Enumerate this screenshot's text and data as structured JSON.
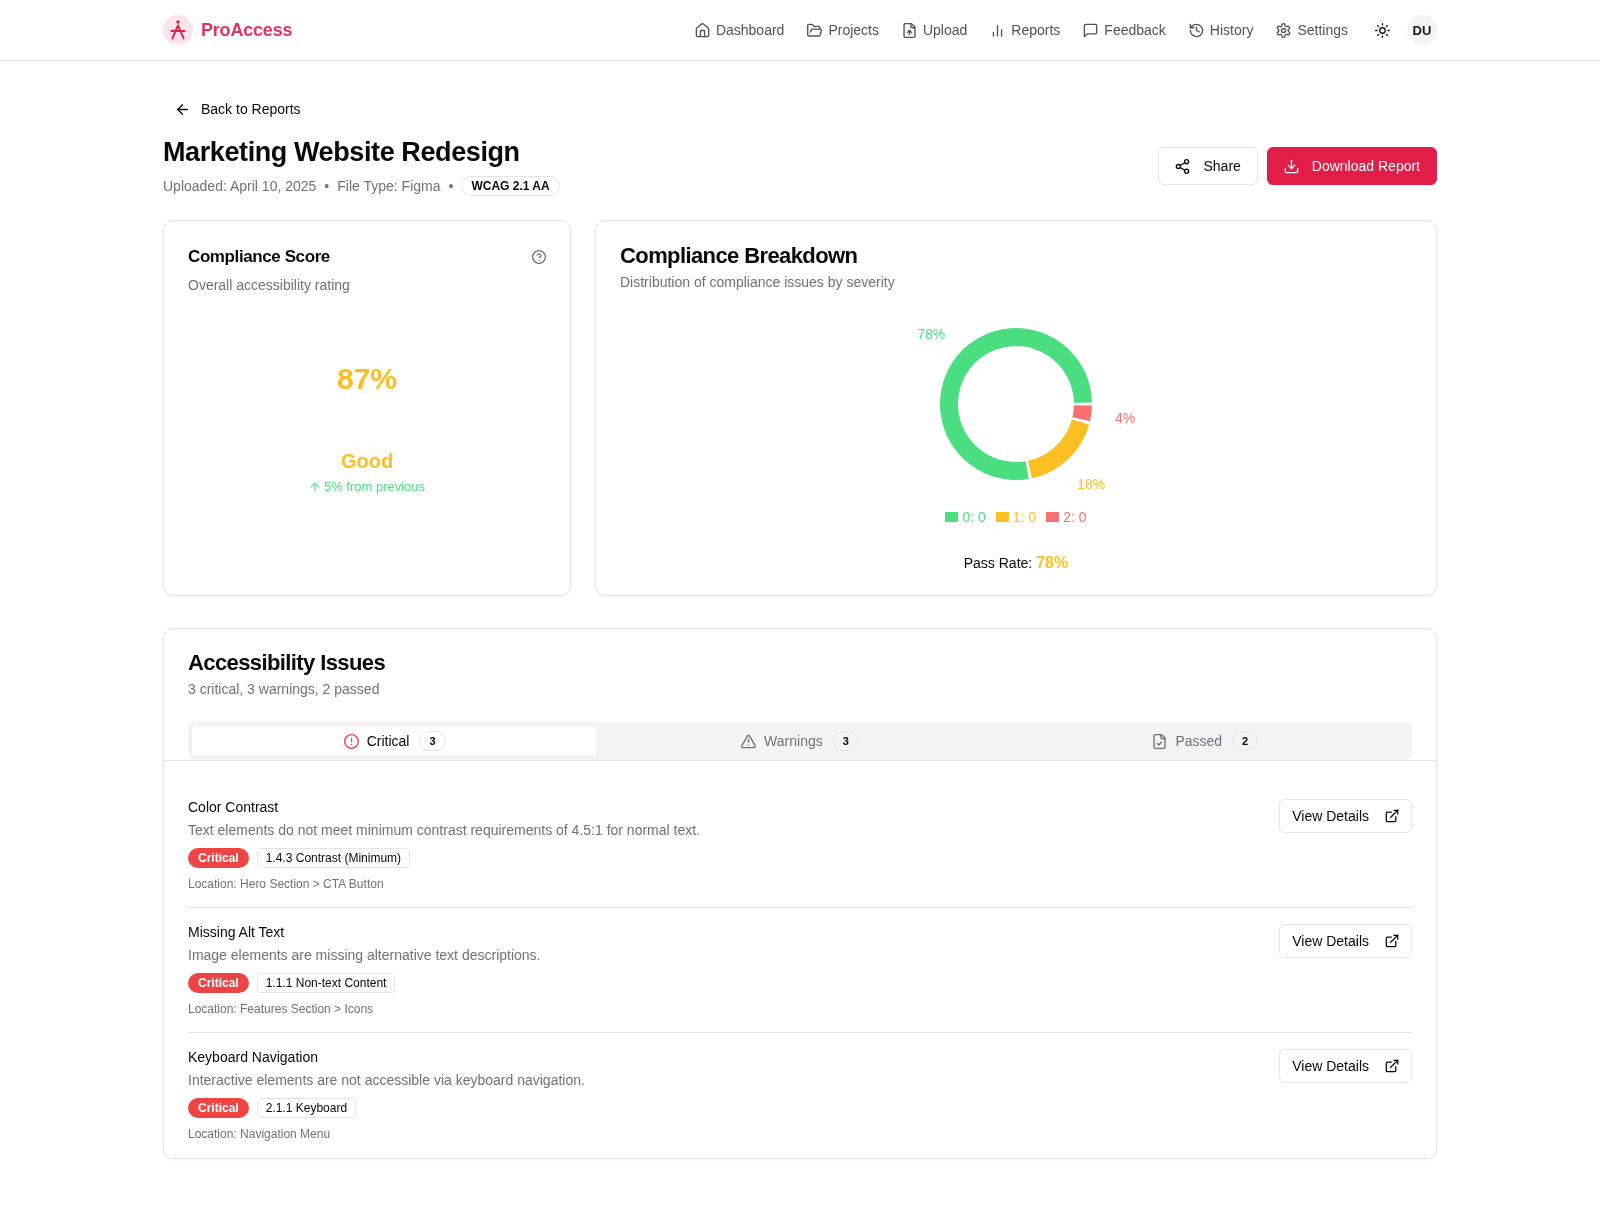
{
  "header": {
    "brand": "ProAccess",
    "nav": [
      "Dashboard",
      "Projects",
      "Upload",
      "Reports",
      "Feedback",
      "History",
      "Settings"
    ],
    "avatar": "DU"
  },
  "back_link": "Back to Reports",
  "report": {
    "title": "Marketing Website Redesign",
    "meta": [
      {
        "kind": "text",
        "text": "Uploaded: April 10, 2025"
      },
      {
        "kind": "separator",
        "text": "•"
      },
      {
        "kind": "text",
        "text": "File Type: Figma"
      },
      {
        "kind": "separator",
        "text": "•"
      },
      {
        "kind": "badge",
        "text": "WCAG 2.1 AA"
      }
    ],
    "actions": [
      {
        "kind": "outline",
        "label": "Share"
      },
      {
        "kind": "primary",
        "label": "Download Report"
      }
    ]
  },
  "score_card": {
    "title": "Compliance Score",
    "subtitle": "Overall accessibility rating",
    "score": "87%",
    "rating": "Good",
    "trend": "5% from previous"
  },
  "breakdown_card": {
    "title": "Compliance Breakdown",
    "subtitle": "Distribution of compliance issues by severity",
    "chart_data": {
      "type": "donut",
      "values": [
        78,
        18,
        4
      ],
      "value_labels": [
        "78%",
        "18%",
        "4%"
      ]
    },
    "legend": [
      {
        "label": "0: 0",
        "color": "#4ade80"
      },
      {
        "label": "1: 0",
        "color": "#fbbf24"
      },
      {
        "label": "2: 0",
        "color": "#f87171"
      }
    ],
    "pass_rate": {
      "label": "Pass Rate:",
      "value": "78%"
    }
  },
  "issues_card": {
    "title": "Accessibility Issues",
    "subtitle": "3 critical, 3 warnings, 2 passed",
    "tabs": [
      {
        "label": "Critical",
        "count": "3",
        "selected": true
      },
      {
        "label": "Warnings",
        "count": "3",
        "selected": false
      },
      {
        "label": "Passed",
        "count": "2",
        "selected": false
      }
    ],
    "issues": [
      {
        "title": "Color Contrast",
        "description": "Text elements do not meet minimum contrast requirements of 4.5:1 for normal text.",
        "badges": [
          {
            "kind": "severity",
            "label": "Critical"
          },
          {
            "kind": "criterion",
            "label": "1.4.3 Contrast (Minimum)"
          }
        ],
        "location": "Location: Hero Section > CTA Button",
        "action": "View Details"
      },
      {
        "title": "Missing Alt Text",
        "description": "Image elements are missing alternative text descriptions.",
        "badges": [
          {
            "kind": "severity",
            "label": "Critical"
          },
          {
            "kind": "criterion",
            "label": "1.1.1 Non-text Content"
          }
        ],
        "location": "Location: Features Section > Icons",
        "action": "View Details"
      },
      {
        "title": "Keyboard Navigation",
        "description": "Interactive elements are not accessible via keyboard navigation.",
        "badges": [
          {
            "kind": "severity",
            "label": "Critical"
          },
          {
            "kind": "criterion",
            "label": "2.1.1 Keyboard"
          }
        ],
        "location": "Location: Navigation Menu",
        "action": "View Details"
      }
    ]
  }
}
